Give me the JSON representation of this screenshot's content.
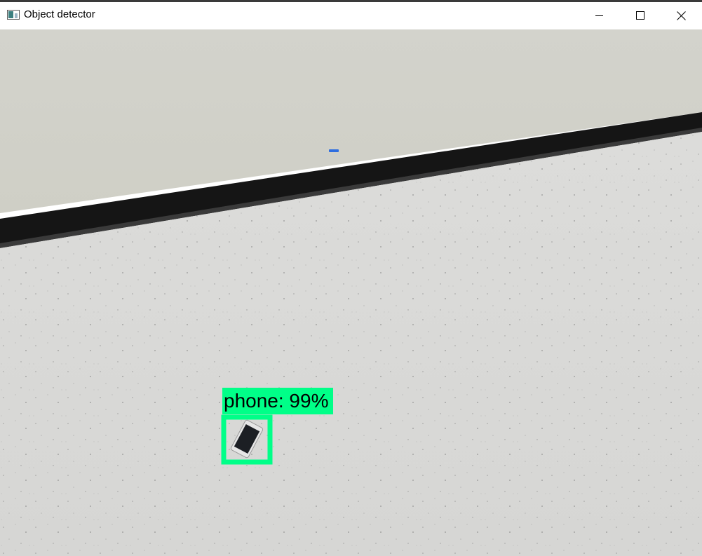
{
  "window": {
    "title": "Object detector",
    "icon": "app-window-icon",
    "controls": [
      "minimize-icon",
      "maximize-icon",
      "close-icon"
    ]
  },
  "detections": [
    {
      "class": "phone",
      "label": "phone: 99%",
      "score": 0.99
    }
  ],
  "colors": {
    "box": "#00ff88",
    "wall": "#d4d4cc",
    "floor": "#d8d8d6",
    "baseboard": "#151515"
  }
}
